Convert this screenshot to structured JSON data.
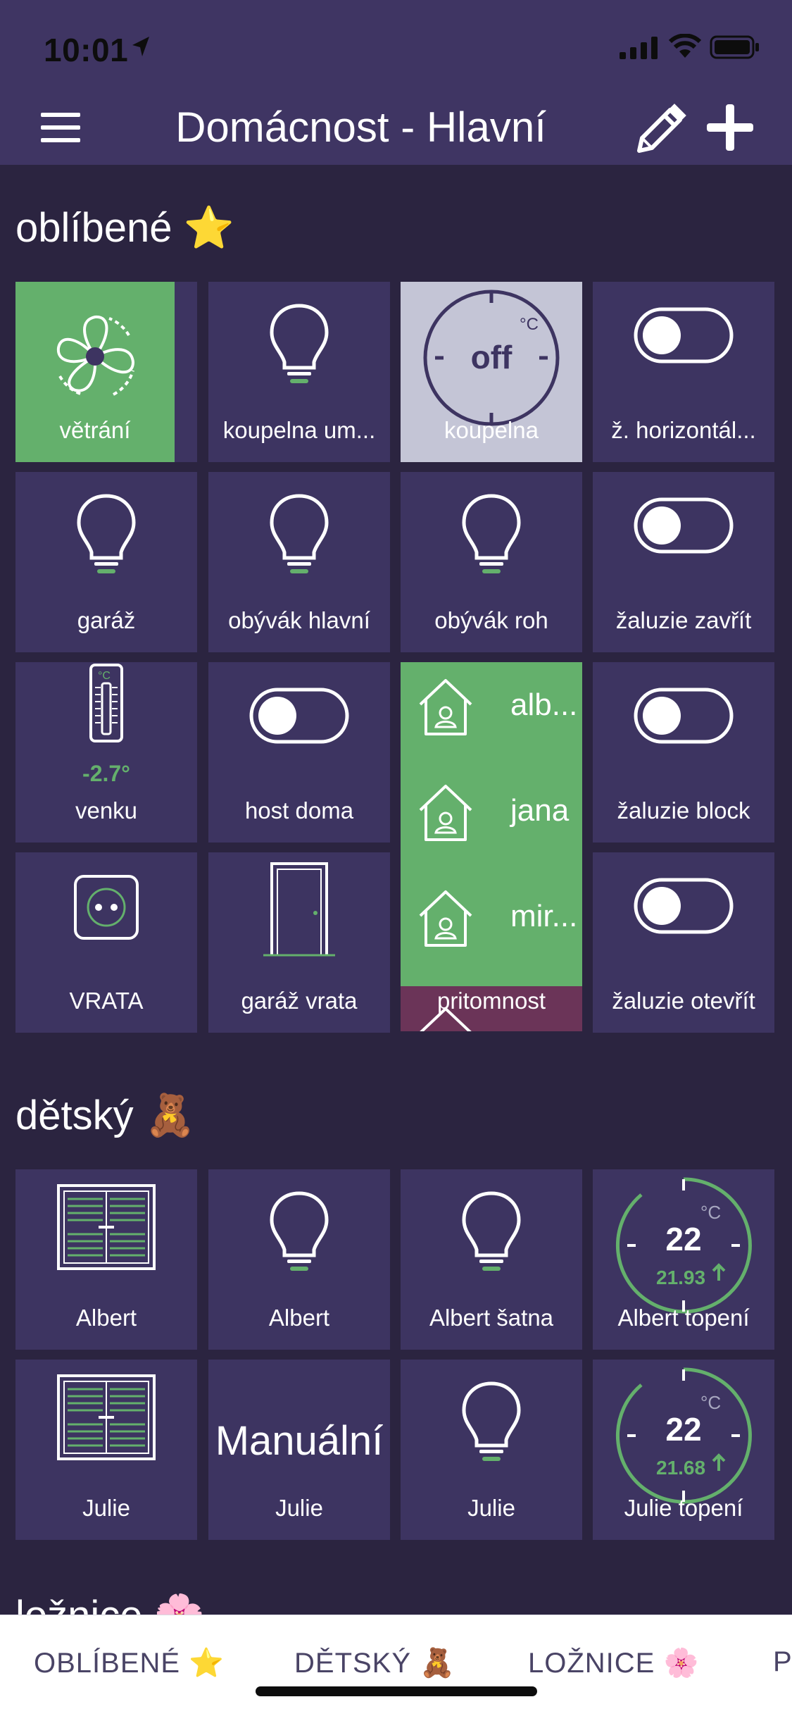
{
  "status_bar": {
    "time": "10:01"
  },
  "header": {
    "title": "Domácnost - Hlavní"
  },
  "sections": {
    "favorites": {
      "title": "oblíbené ⭐"
    },
    "kids": {
      "title": "dětský 🧸"
    },
    "bedroom": {
      "title": "ložnice 🌸"
    }
  },
  "favorites_tiles": {
    "t1": "větrání",
    "t2": "koupelna um...",
    "t3": "koupelna",
    "t3_state": "off",
    "t4": "ž. horizontál...",
    "t5": "garáž",
    "t6": "obývák hlavní",
    "t7": "obývák roh",
    "t8": "žaluzie zavřít",
    "t9": "venku",
    "t9_temp": "-2.7°",
    "t10": "host doma",
    "t12": "žaluzie block",
    "t13": "VRATA",
    "t14": "garáž vrata",
    "t16": "žaluzie otevřít"
  },
  "presence": {
    "label": "pritomnost",
    "people": [
      "alb...",
      "jana",
      "mir..."
    ]
  },
  "kids_tiles": {
    "k1": "Albert",
    "k2": "Albert",
    "k3": "Albert šatna",
    "k4": "Albert topení",
    "k4_set": "22",
    "k4_cur": "21.93",
    "k5": "Julie",
    "k6_text": "Manuální",
    "k6": "Julie",
    "k7": "Julie",
    "k8": "Julie topení",
    "k8_set": "22",
    "k8_cur": "21.68"
  },
  "tabs": [
    "OBLÍBENÉ ⭐",
    "DĚTSKÝ 🧸",
    "LOŽNICE 🌸",
    "P"
  ],
  "colors": {
    "background": "#2b2440",
    "header": "#3f3563",
    "tile": "#3d3461",
    "accent_green": "#64b06c",
    "presence_away": "#6b3458"
  }
}
